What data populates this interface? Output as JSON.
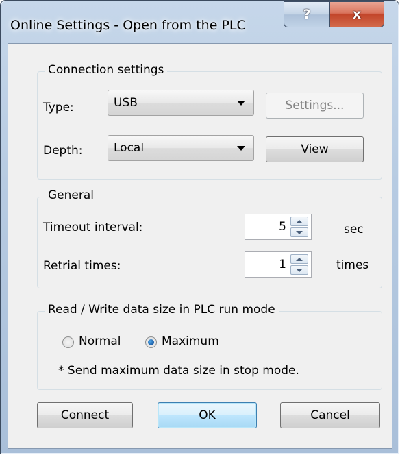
{
  "window": {
    "title": "Online Settings - Open from the PLC",
    "help_glyph": "?",
    "close_glyph": "x"
  },
  "connection": {
    "legend": "Connection settings",
    "type_label": "Type:",
    "type_value": "USB",
    "settings_button": "Settings...",
    "depth_label": "Depth:",
    "depth_value": "Local",
    "view_button": "View"
  },
  "general": {
    "legend": "General",
    "timeout_label": "Timeout interval:",
    "timeout_value": "5",
    "timeout_unit": "sec",
    "retrial_label": "Retrial times:",
    "retrial_value": "1",
    "retrial_unit": "times"
  },
  "datasize": {
    "legend": "Read / Write data size in PLC run mode",
    "normal_label": "Normal",
    "maximum_label": "Maximum",
    "selected": "Maximum",
    "note": "* Send maximum data size in stop mode."
  },
  "buttons": {
    "connect": "Connect",
    "ok": "OK",
    "cancel": "Cancel"
  }
}
